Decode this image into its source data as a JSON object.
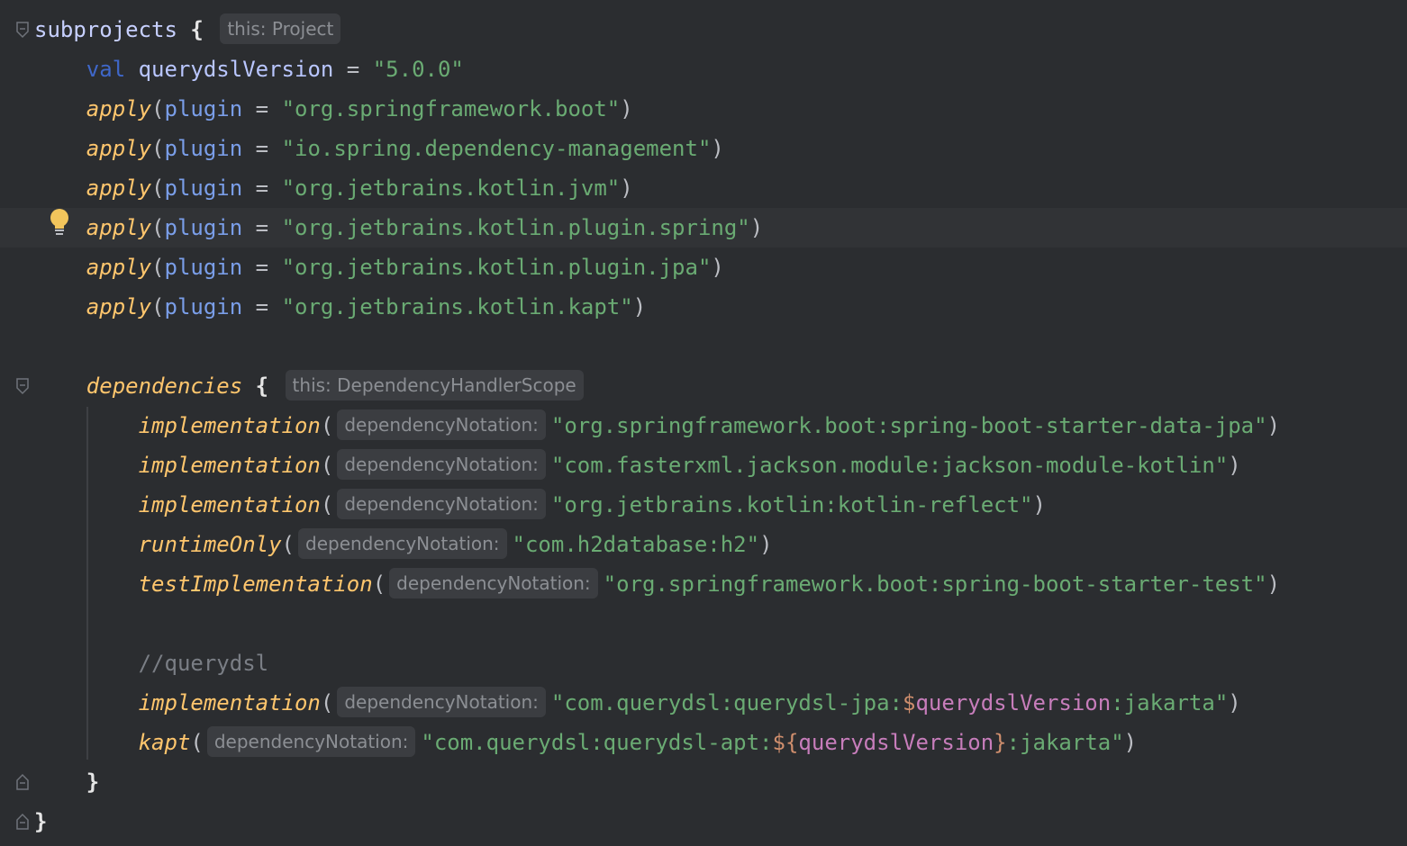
{
  "editor": {
    "lines": [
      {
        "tokens": [
          {
            "t": "subprojects",
            "c": "t-ident"
          },
          {
            "t": " ",
            "c": "t-plain"
          },
          {
            "t": "{",
            "c": "t-brace"
          },
          {
            "t": " ",
            "c": "t-plain"
          },
          {
            "hint": "this: Project"
          }
        ]
      },
      {
        "tokens": [
          {
            "t": "    ",
            "c": "t-plain"
          },
          {
            "t": "val",
            "c": "t-val"
          },
          {
            "t": " ",
            "c": "t-plain"
          },
          {
            "t": "querydslVersion",
            "c": "t-var"
          },
          {
            "t": " = ",
            "c": "t-op"
          },
          {
            "t": "\"5.0.0\"",
            "c": "t-str"
          }
        ]
      },
      {
        "tokens": [
          {
            "t": "    ",
            "c": "t-plain"
          },
          {
            "t": "apply",
            "c": "t-fn"
          },
          {
            "t": "(",
            "c": "t-op"
          },
          {
            "t": "plugin",
            "c": "t-param"
          },
          {
            "t": " = ",
            "c": "t-op"
          },
          {
            "t": "\"org.springframework.boot\"",
            "c": "t-str"
          },
          {
            "t": ")",
            "c": "t-op"
          }
        ]
      },
      {
        "tokens": [
          {
            "t": "    ",
            "c": "t-plain"
          },
          {
            "t": "apply",
            "c": "t-fn"
          },
          {
            "t": "(",
            "c": "t-op"
          },
          {
            "t": "plugin",
            "c": "t-param"
          },
          {
            "t": " = ",
            "c": "t-op"
          },
          {
            "t": "\"io.spring.dependency-management\"",
            "c": "t-str"
          },
          {
            "t": ")",
            "c": "t-op"
          }
        ]
      },
      {
        "tokens": [
          {
            "t": "    ",
            "c": "t-plain"
          },
          {
            "t": "apply",
            "c": "t-fn"
          },
          {
            "t": "(",
            "c": "t-op"
          },
          {
            "t": "plugin",
            "c": "t-param"
          },
          {
            "t": " = ",
            "c": "t-op"
          },
          {
            "t": "\"org.jetbrains.kotlin.jvm\"",
            "c": "t-str"
          },
          {
            "t": ")",
            "c": "t-op"
          }
        ]
      },
      {
        "current": true,
        "tokens": [
          {
            "t": "    ",
            "c": "t-plain"
          },
          {
            "t": "apply",
            "c": "t-fn"
          },
          {
            "t": "(",
            "c": "t-op"
          },
          {
            "t": "plugin",
            "c": "t-param"
          },
          {
            "t": " = ",
            "c": "t-op"
          },
          {
            "t": "\"org.jetbrains.kotlin.plugin.spring\"",
            "c": "t-str"
          },
          {
            "t": ")",
            "c": "t-op"
          }
        ]
      },
      {
        "tokens": [
          {
            "t": "    ",
            "c": "t-plain"
          },
          {
            "t": "apply",
            "c": "t-fn"
          },
          {
            "t": "(",
            "c": "t-op"
          },
          {
            "t": "plugin",
            "c": "t-param"
          },
          {
            "t": " = ",
            "c": "t-op"
          },
          {
            "t": "\"org.jetbrains.kotlin.plugin.jpa\"",
            "c": "t-str"
          },
          {
            "t": ")",
            "c": "t-op"
          }
        ]
      },
      {
        "tokens": [
          {
            "t": "    ",
            "c": "t-plain"
          },
          {
            "t": "apply",
            "c": "t-fn"
          },
          {
            "t": "(",
            "c": "t-op"
          },
          {
            "t": "plugin",
            "c": "t-param"
          },
          {
            "t": " = ",
            "c": "t-op"
          },
          {
            "t": "\"org.jetbrains.kotlin.kapt\"",
            "c": "t-str"
          },
          {
            "t": ")",
            "c": "t-op"
          }
        ]
      },
      {
        "tokens": []
      },
      {
        "tokens": [
          {
            "t": "    ",
            "c": "t-plain"
          },
          {
            "t": "dependencies",
            "c": "t-fn"
          },
          {
            "t": " ",
            "c": "t-plain"
          },
          {
            "t": "{",
            "c": "t-brace"
          },
          {
            "t": " ",
            "c": "t-plain"
          },
          {
            "hint": "this: DependencyHandlerScope"
          }
        ]
      },
      {
        "tokens": [
          {
            "t": "        ",
            "c": "t-plain"
          },
          {
            "t": "implementation",
            "c": "t-fn"
          },
          {
            "t": "(",
            "c": "t-op"
          },
          {
            "hint": "dependencyNotation:"
          },
          {
            "t": "\"org.springframework.boot:spring-boot-starter-data-jpa\"",
            "c": "t-str"
          },
          {
            "t": ")",
            "c": "t-op"
          }
        ]
      },
      {
        "tokens": [
          {
            "t": "        ",
            "c": "t-plain"
          },
          {
            "t": "implementation",
            "c": "t-fn"
          },
          {
            "t": "(",
            "c": "t-op"
          },
          {
            "hint": "dependencyNotation:"
          },
          {
            "t": "\"com.fasterxml.jackson.module:jackson-module-kotlin\"",
            "c": "t-str"
          },
          {
            "t": ")",
            "c": "t-op"
          }
        ]
      },
      {
        "tokens": [
          {
            "t": "        ",
            "c": "t-plain"
          },
          {
            "t": "implementation",
            "c": "t-fn"
          },
          {
            "t": "(",
            "c": "t-op"
          },
          {
            "hint": "dependencyNotation:"
          },
          {
            "t": "\"org.jetbrains.kotlin:kotlin-reflect\"",
            "c": "t-str"
          },
          {
            "t": ")",
            "c": "t-op"
          }
        ]
      },
      {
        "tokens": [
          {
            "t": "        ",
            "c": "t-plain"
          },
          {
            "t": "runtimeOnly",
            "c": "t-fn"
          },
          {
            "t": "(",
            "c": "t-op"
          },
          {
            "hint": "dependencyNotation:"
          },
          {
            "t": "\"com.h2database:h2\"",
            "c": "t-str"
          },
          {
            "t": ")",
            "c": "t-op"
          }
        ]
      },
      {
        "tokens": [
          {
            "t": "        ",
            "c": "t-plain"
          },
          {
            "t": "testImplementation",
            "c": "t-fn"
          },
          {
            "t": "(",
            "c": "t-op"
          },
          {
            "hint": "dependencyNotation:"
          },
          {
            "t": "\"org.springframework.boot:spring-boot-starter-test\"",
            "c": "t-str"
          },
          {
            "t": ")",
            "c": "t-op"
          }
        ]
      },
      {
        "tokens": []
      },
      {
        "tokens": [
          {
            "t": "        ",
            "c": "t-plain"
          },
          {
            "t": "//querydsl",
            "c": "t-comment"
          }
        ]
      },
      {
        "tokens": [
          {
            "t": "        ",
            "c": "t-plain"
          },
          {
            "t": "implementation",
            "c": "t-fn"
          },
          {
            "t": "(",
            "c": "t-op"
          },
          {
            "hint": "dependencyNotation:"
          },
          {
            "t": "\"com.querydsl:querydsl-jpa:",
            "c": "t-str"
          },
          {
            "t": "$",
            "c": "t-interp"
          },
          {
            "t": "querydslVersion",
            "c": "t-interp-var"
          },
          {
            "t": ":jakarta\"",
            "c": "t-str"
          },
          {
            "t": ")",
            "c": "t-op"
          }
        ]
      },
      {
        "tokens": [
          {
            "t": "        ",
            "c": "t-plain"
          },
          {
            "t": "kapt",
            "c": "t-fn"
          },
          {
            "t": "(",
            "c": "t-op"
          },
          {
            "hint": "dependencyNotation:"
          },
          {
            "t": "\"com.querydsl:querydsl-apt:",
            "c": "t-str"
          },
          {
            "t": "${",
            "c": "t-interp"
          },
          {
            "t": "querydslVersion",
            "c": "t-interp-var"
          },
          {
            "t": "}",
            "c": "t-interp"
          },
          {
            "t": ":jakarta\"",
            "c": "t-str"
          },
          {
            "t": ")",
            "c": "t-op"
          }
        ]
      },
      {
        "tokens": [
          {
            "t": "    ",
            "c": "t-plain"
          },
          {
            "t": "}",
            "c": "t-brace"
          }
        ]
      },
      {
        "tokens": [
          {
            "t": "}",
            "c": "t-brace"
          }
        ]
      }
    ],
    "colors": {
      "background": "#2b2d30",
      "current_line": "#313336",
      "string": "#6aab73",
      "function": "#ffc66d",
      "keyword_val": "#3f67c9",
      "param": "#7a9ee9",
      "interp": "#cf8e6d",
      "comment": "#7a7e85"
    },
    "icons": [
      "fold-open-icon",
      "fold-close-icon",
      "lightbulb-icon"
    ]
  }
}
